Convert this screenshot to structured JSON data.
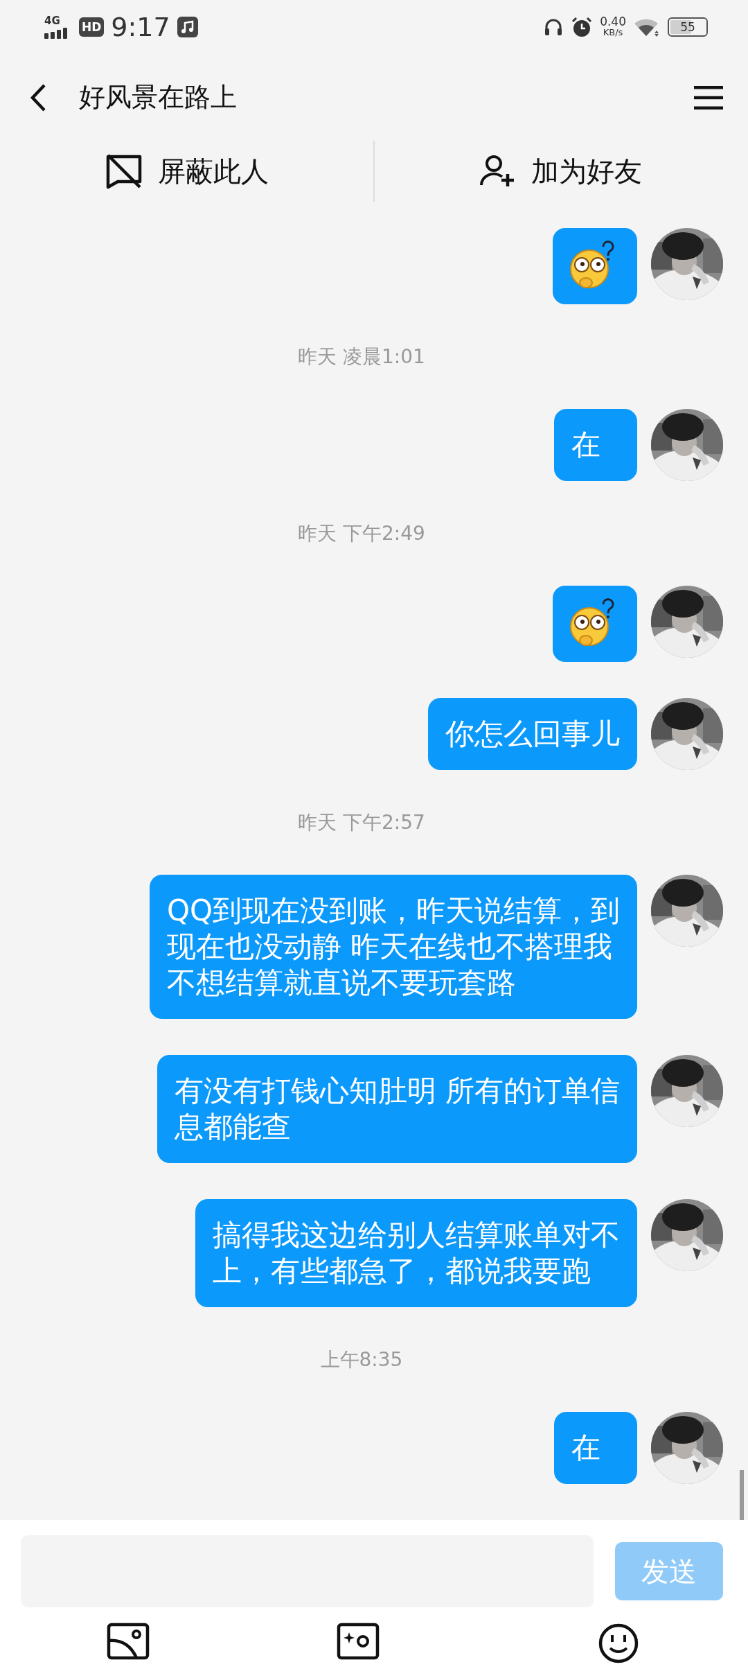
{
  "status_bar": {
    "network": "4G",
    "hd": "HD",
    "time": "9:17",
    "speed": "0.40",
    "speed_unit": "KB/s",
    "battery": "55"
  },
  "header": {
    "title": "好风景在路上"
  },
  "actions": [
    {
      "kind": "block",
      "label": "屏蔽此人"
    },
    {
      "kind": "add_friend",
      "label": "加为好友"
    }
  ],
  "messages": [
    {
      "kind": "sticker"
    },
    {
      "kind": "time",
      "text": "昨天 凌晨1:01"
    },
    {
      "kind": "text",
      "lines": [
        "在"
      ]
    },
    {
      "kind": "time",
      "text": "昨天 下午2:49"
    },
    {
      "kind": "sticker"
    },
    {
      "kind": "text",
      "lines": [
        "你怎么回事儿"
      ]
    },
    {
      "kind": "time",
      "text": "昨天 下午2:57"
    },
    {
      "kind": "text",
      "lines": [
        "QQ到现在没到账，昨天说结算，到",
        "现在也没动静 昨天在线也不搭理我",
        "不想结算就直说不要玩套路"
      ]
    },
    {
      "kind": "text",
      "lines": [
        "有没有打钱心知肚明 所有的订单信",
        "息都能查"
      ]
    },
    {
      "kind": "text",
      "lines": [
        "搞得我这边给别人结算账单对不",
        "上，有些都急了，都说我要跑"
      ]
    },
    {
      "kind": "time",
      "text": "上午8:35"
    },
    {
      "kind": "text",
      "lines": [
        "在"
      ]
    }
  ],
  "composer": {
    "send": "发送"
  }
}
